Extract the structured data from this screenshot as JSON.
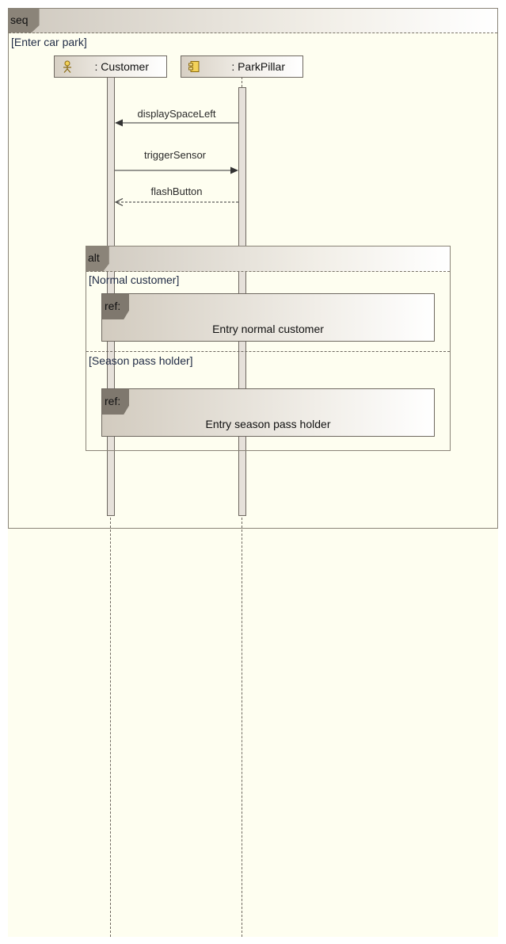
{
  "sequence_frame": {
    "operator": "seq",
    "guard": "[Enter car park]"
  },
  "lifelines": [
    {
      "name": ": Customer",
      "icon": "actor-icon"
    },
    {
      "name": ": ParkPillar",
      "icon": "component-icon"
    }
  ],
  "messages": [
    {
      "label": "displaySpaceLeft",
      "from": ": ParkPillar",
      "to": ": Customer",
      "kind": "synchronous"
    },
    {
      "label": "triggerSensor",
      "from": ": Customer",
      "to": ": ParkPillar",
      "kind": "synchronous"
    },
    {
      "label": "flashButton",
      "from": ": ParkPillar",
      "to": ": Customer",
      "kind": "reply"
    }
  ],
  "alt_fragment": {
    "operator": "alt",
    "operands": [
      {
        "guard": "[Normal customer]",
        "ref_tag": "ref:",
        "ref_name": "Entry normal customer"
      },
      {
        "guard": "[Season pass holder]",
        "ref_tag": "ref:",
        "ref_name": "Entry season pass holder"
      }
    ]
  }
}
